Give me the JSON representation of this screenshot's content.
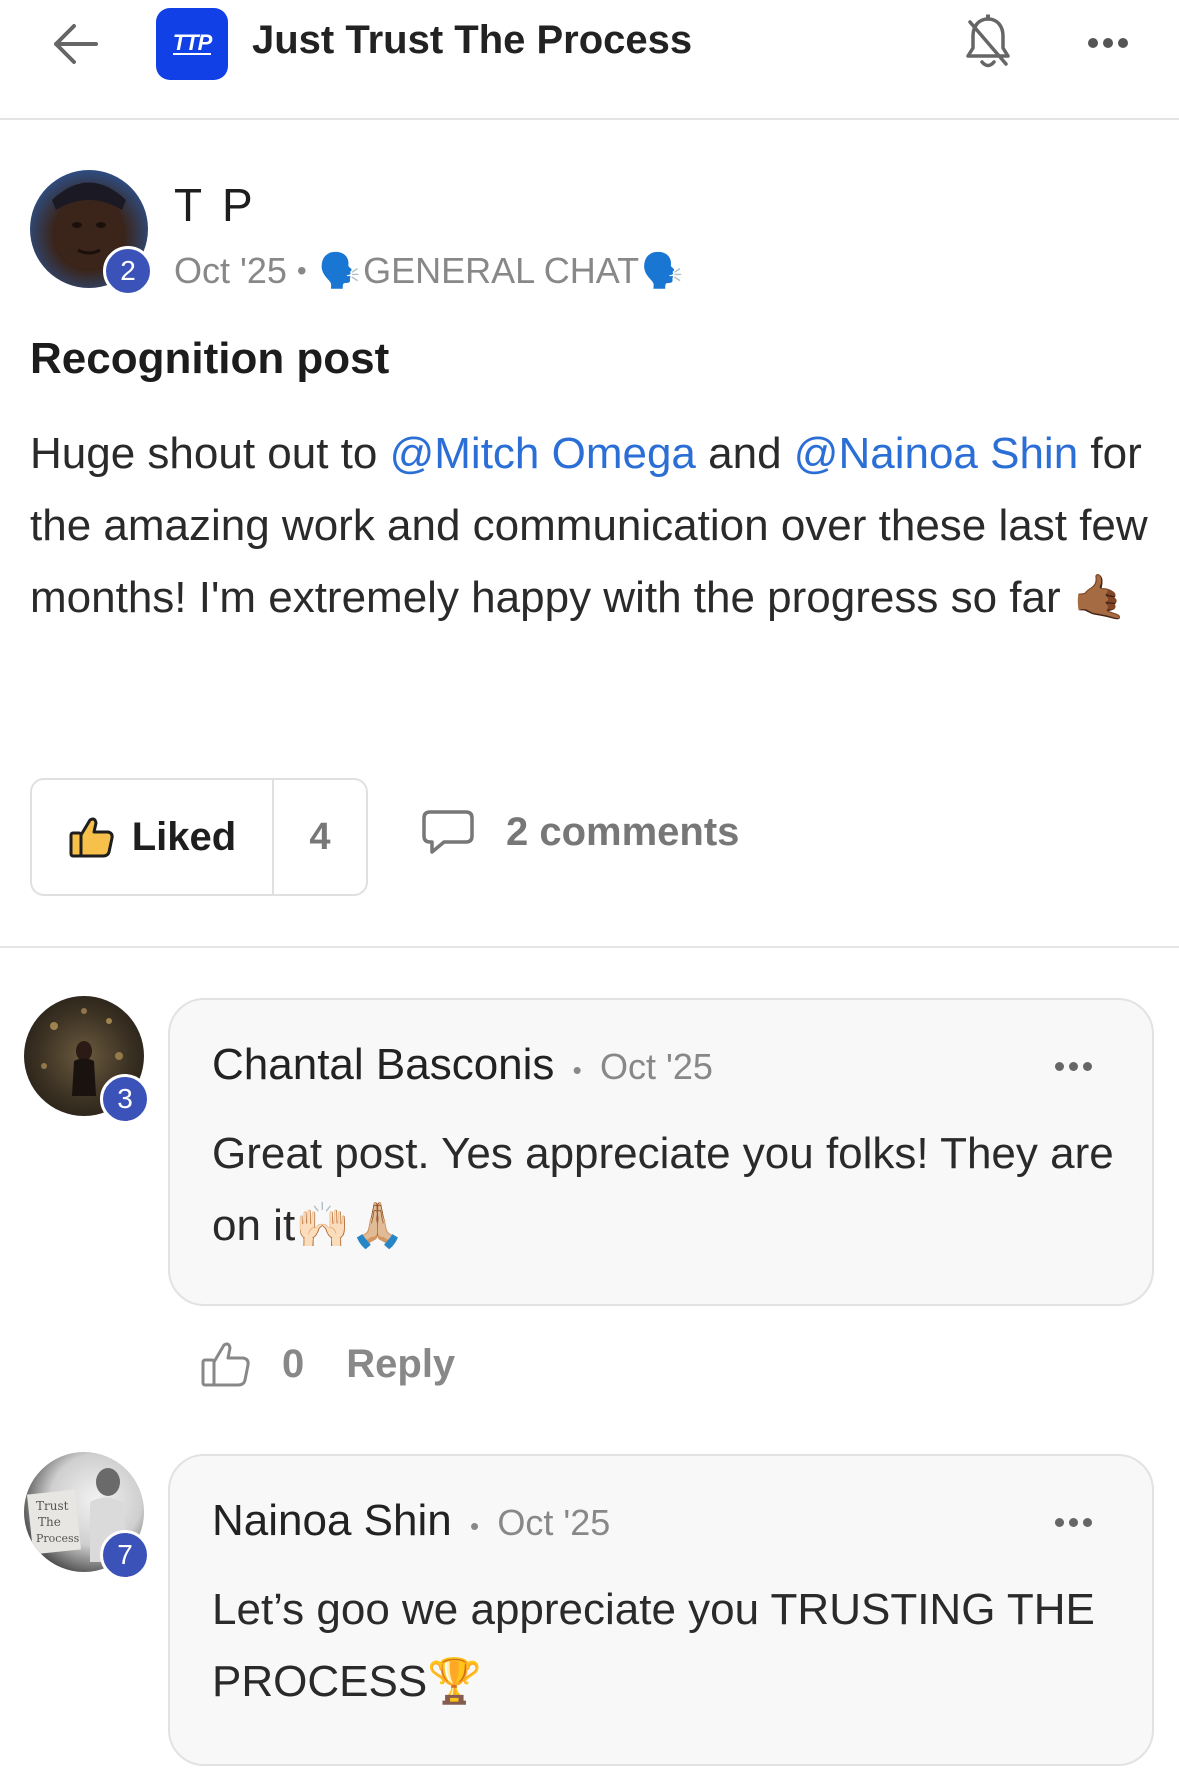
{
  "header": {
    "title": "Just Trust The Process",
    "logo_text": "TTP",
    "back_icon": "arrow-left-icon",
    "bell_icon": "bell-off-icon",
    "more_icon": "more-horizontal-icon"
  },
  "post": {
    "author": "T P",
    "author_level": "2",
    "date": "Oct '25",
    "separator": "•",
    "category_emoji": "🗣️",
    "category": "GENERAL CHAT",
    "title": "Recognition post",
    "body_parts": {
      "p1": "Huge shout out to ",
      "m1": "@Mitch Omega",
      "p2": " and ",
      "m2": "@Nainoa Shin",
      "p3": " for the amazing work and communication over these last few months! I'm extremely happy with the progress so far ",
      "emoji": "🤙🏾"
    },
    "like_label": "Liked",
    "like_count": "4",
    "comments_label": "2 comments"
  },
  "comments": [
    {
      "author": "Chantal Basconis",
      "level": "3",
      "separator": "•",
      "date": "Oct '25",
      "text": "Great post. Yes appreciate you folks! They are on it🙌🏻🙏🏼",
      "like_count": "0",
      "reply_label": "Reply"
    },
    {
      "author": "Nainoa Shin",
      "level": "7",
      "separator": "•",
      "date": "Oct '25",
      "text": "Let’s goo we appreciate you TRUSTING THE PROCESS🏆"
    }
  ],
  "colors": {
    "accent_blue": "#2b6fd6",
    "badge": "#3b52b8",
    "logo_bg": "#1140e6"
  }
}
